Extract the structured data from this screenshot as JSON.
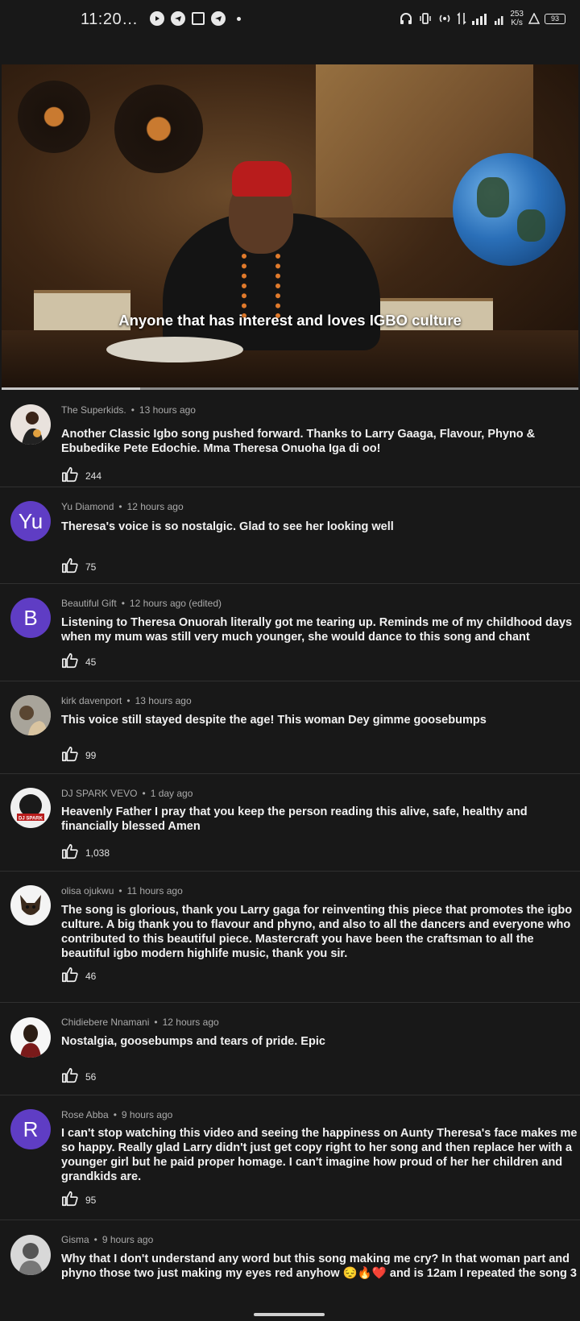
{
  "status_bar": {
    "time": "11:20…",
    "net_speed_value": "253",
    "net_speed_unit": "K/s",
    "network": "4G",
    "battery": "93"
  },
  "video": {
    "caption": "Anyone that has interest and loves IGBO culture",
    "progress_percent": 24
  },
  "comments": [
    {
      "author": "The Superkids.",
      "time": "13 hours ago",
      "text": "Another Classic Igbo song pushed forward.  Thanks to Larry Gaaga, Flavour, Phyno & Ebubedike Pete Edochie. Mma Theresa Onuoha Iga di oo!",
      "likes": "244",
      "avatar": ""
    },
    {
      "author": "Yu Diamond",
      "time": "12 hours ago",
      "text": "Theresa's voice is so nostalgic. Glad to see her looking well",
      "likes": "75",
      "avatar": "Yu"
    },
    {
      "author": "Beautiful Gift",
      "time": "12 hours ago (edited)",
      "text": "Listening to Theresa Onuorah literally got me tearing up. Reminds me of my childhood days when my mum was still very much younger, she would dance to this song and chant",
      "likes": "45",
      "avatar": "B"
    },
    {
      "author": "kirk davenport",
      "time": "13 hours ago",
      "text": "This voice still stayed despite the age! This woman Dey gimme goosebumps",
      "likes": "99",
      "avatar": ""
    },
    {
      "author": "DJ SPARK VEVO",
      "time": "1 day ago",
      "text": "Heavenly Father I pray that you keep the person reading this alive, safe, healthy and financially blessed Amen",
      "likes": "1,038",
      "avatar": "DJ SPARK"
    },
    {
      "author": "olisa ojukwu",
      "time": "11 hours ago",
      "text": "The song is glorious, thank you Larry gaga for reinventing this piece that promotes the igbo culture. A big thank you to flavour and phyno, and also  to all the dancers and everyone who contributed to this beautiful piece. Mastercraft you have been the craftsman to all the beautiful igbo modern highlife music, thank you sir.",
      "likes": "46",
      "avatar": ""
    },
    {
      "author": "Chidiebere Nnamani",
      "time": "12 hours ago",
      "text": "Nostalgia, goosebumps and tears of pride. Epic",
      "likes": "56",
      "avatar": ""
    },
    {
      "author": "Rose Abba",
      "time": "9 hours ago",
      "text": "I can't stop watching this video and seeing the happiness on Aunty Theresa's face makes me so happy. Really glad Larry didn't just get copy right to her song and then replace her with a younger girl but he paid proper homage. I can't imagine how proud of her her children and grandkids are.",
      "likes": "95",
      "avatar": "R"
    },
    {
      "author": "Gisma",
      "time": "9 hours ago",
      "text": "Why that I don't understand any word but this song making me cry? In that woman part and phyno those two just making my eyes red anyhow 😔🔥❤️ and is 12am I repeated the song 3",
      "likes": "",
      "avatar": ""
    }
  ],
  "colors": {
    "background": "#181818",
    "avatar_purple": "#5f3dc4",
    "text": "#f1f1f1",
    "meta": "#aaaaaa"
  }
}
